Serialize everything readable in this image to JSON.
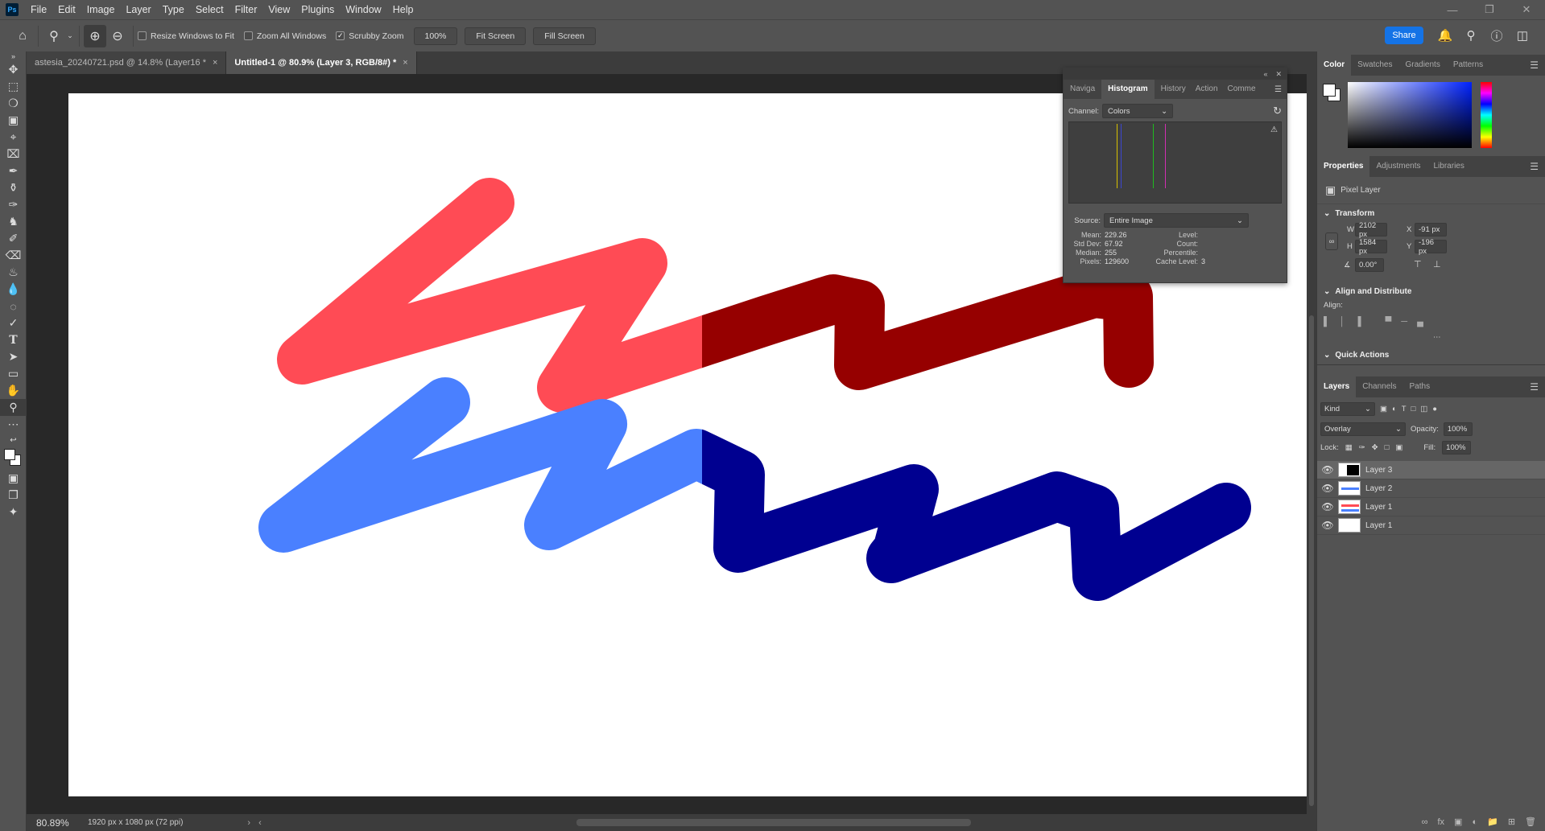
{
  "app": {
    "logo": "Ps"
  },
  "menu": [
    "File",
    "Edit",
    "Image",
    "Layer",
    "Type",
    "Select",
    "Filter",
    "View",
    "Plugins",
    "Window",
    "Help"
  ],
  "options": {
    "resize_windows": "Resize Windows to Fit",
    "zoom_all": "Zoom All Windows",
    "scrubby": "Scrubby Zoom",
    "zoom_pct": "100%",
    "fit_screen": "Fit Screen",
    "fill_screen": "Fill Screen",
    "share": "Share"
  },
  "tabs": [
    {
      "label": "astesia_20240721.psd @ 14.8% (Layer16 *",
      "close": "×"
    },
    {
      "label": "Untitled-1 @ 80.9% (Layer 3, RGB/8#) *",
      "close": "×"
    }
  ],
  "histogram": {
    "tabs": [
      "Naviga",
      "Histogram",
      "History",
      "Action",
      "Comme"
    ],
    "channel_label": "Channel:",
    "channel_value": "Colors",
    "source_label": "Source:",
    "source_value": "Entire Image",
    "stats": {
      "mean_label": "Mean:",
      "mean": "229.26",
      "stddev_label": "Std Dev:",
      "stddev": "67.92",
      "median_label": "Median:",
      "median": "255",
      "pixels_label": "Pixels:",
      "pixels": "129600",
      "level_label": "Level:",
      "count_label": "Count:",
      "percentile_label": "Percentile:",
      "cache_label": "Cache Level:",
      "cache": "3"
    }
  },
  "color_panel": {
    "tabs": [
      "Color",
      "Swatches",
      "Gradients",
      "Patterns"
    ]
  },
  "properties": {
    "tabs": [
      "Properties",
      "Adjustments",
      "Libraries"
    ],
    "layer_type": "Pixel Layer",
    "transform_title": "Transform",
    "w_label": "W",
    "w": "2102 px",
    "x_label": "X",
    "x": "-91 px",
    "h_label": "H",
    "h": "1584 px",
    "y_label": "Y",
    "y": "-196 px",
    "angle": "0.00°",
    "align_title": "Align and Distribute",
    "align_label": "Align:",
    "quick_actions": "Quick Actions"
  },
  "layers_panel": {
    "tabs": [
      "Layers",
      "Channels",
      "Paths"
    ],
    "kind": "Kind",
    "blend": "Overlay",
    "opacity_label": "Opacity:",
    "opacity": "100%",
    "lock_label": "Lock:",
    "fill_label": "Fill:",
    "fill": "100%",
    "layers": [
      {
        "name": "Layer 3",
        "selected": true
      },
      {
        "name": "Layer 2",
        "selected": false
      },
      {
        "name": "Layer 1",
        "selected": false
      },
      {
        "name": "Layer 1",
        "selected": false
      }
    ]
  },
  "status": {
    "zoom": "80.89%",
    "doc_info": "1920 px x 1080 px (72 ppi)"
  },
  "colors": {
    "light_red": "#ff4b55",
    "dark_red": "#960000",
    "light_blue": "#4a80ff",
    "dark_blue": "#000090"
  }
}
